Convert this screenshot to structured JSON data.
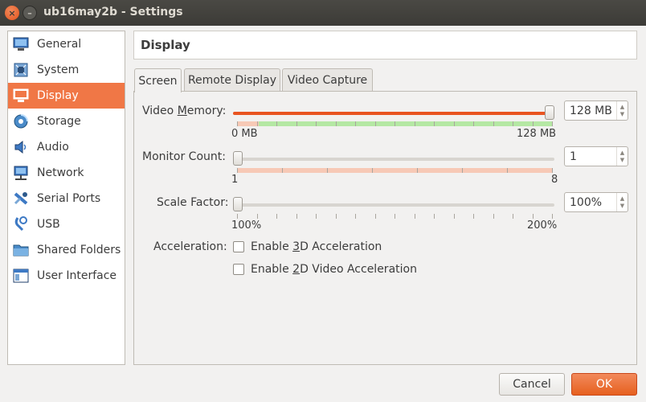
{
  "window": {
    "title": "ub16may2b - Settings",
    "close_glyph": "×",
    "minimize_glyph": "–"
  },
  "sidebar": {
    "items": [
      {
        "label": "General",
        "icon": "monitor-icon"
      },
      {
        "label": "System",
        "icon": "chip-icon"
      },
      {
        "label": "Display",
        "icon": "display-icon"
      },
      {
        "label": "Storage",
        "icon": "disk-icon"
      },
      {
        "label": "Audio",
        "icon": "speaker-icon"
      },
      {
        "label": "Network",
        "icon": "network-icon"
      },
      {
        "label": "Serial Ports",
        "icon": "serial-port-icon"
      },
      {
        "label": "USB",
        "icon": "usb-icon"
      },
      {
        "label": "Shared Folders",
        "icon": "folder-icon"
      },
      {
        "label": "User Interface",
        "icon": "ui-window-icon"
      }
    ],
    "selected": "Display"
  },
  "header": {
    "title": "Display"
  },
  "tabs": [
    {
      "label": "Screen",
      "active": true
    },
    {
      "label": "Remote Display",
      "active": false
    },
    {
      "label": "Video Capture",
      "active": false
    }
  ],
  "screen": {
    "video_memory": {
      "label_pre": "Video ",
      "label_accel": "M",
      "label_post": "emory:",
      "value": "128 MB",
      "min_label": "0 MB",
      "max_label": "128 MB",
      "fraction": 1.0
    },
    "monitor_count": {
      "label": "Monitor Count:",
      "value": "1",
      "min_label": "1",
      "max_label": "8",
      "fraction": 0.0
    },
    "scale_factor": {
      "label": "Scale Factor:",
      "value": "100%",
      "min_label": "100%",
      "max_label": "200%",
      "fraction": 0.0
    },
    "acceleration": {
      "label": "Acceleration:",
      "enable_3d": {
        "pre": "Enable ",
        "accel": "3",
        "post": "D Acceleration",
        "checked": false
      },
      "enable_2d": {
        "pre": "Enable ",
        "accel": "2",
        "post": "D Video Acceleration",
        "checked": false
      }
    }
  },
  "buttons": {
    "cancel": {
      "label": "Cancel"
    },
    "ok": {
      "label": "OK"
    }
  },
  "colors": {
    "accent": "#f07746",
    "slider_fill": "#e95420",
    "green_band": "#b5e8a4",
    "red_band": "#f7c9b6"
  }
}
